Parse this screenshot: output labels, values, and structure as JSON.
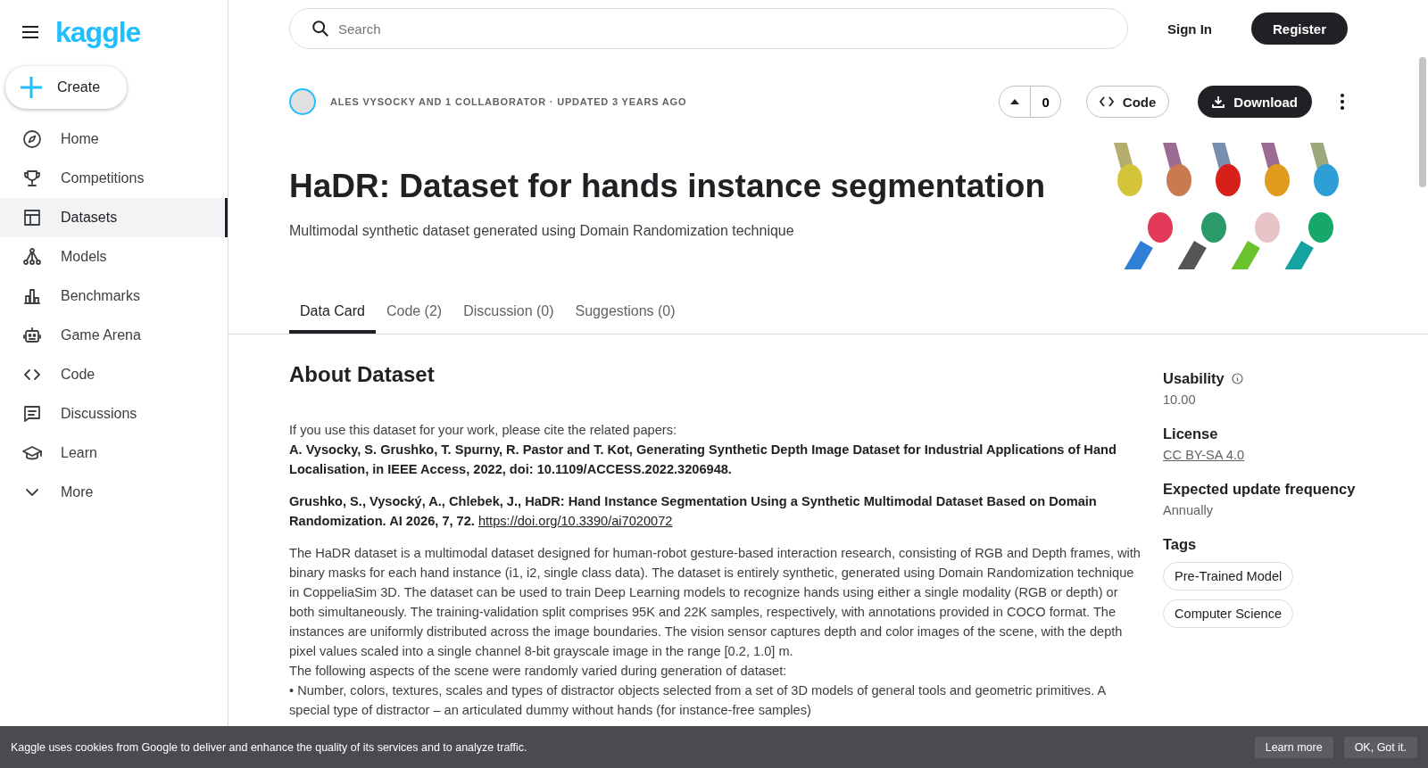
{
  "logo": "kaggle",
  "create_button": "Create",
  "nav": [
    {
      "label": "Home",
      "selected": false
    },
    {
      "label": "Competitions",
      "selected": false
    },
    {
      "label": "Datasets",
      "selected": true
    },
    {
      "label": "Models",
      "selected": false
    },
    {
      "label": "Benchmarks",
      "selected": false
    },
    {
      "label": "Game Arena",
      "selected": false
    },
    {
      "label": "Code",
      "selected": false
    },
    {
      "label": "Discussions",
      "selected": false
    },
    {
      "label": "Learn",
      "selected": false
    },
    {
      "label": "More",
      "selected": false
    }
  ],
  "search": {
    "placeholder": "Search"
  },
  "sign_in": "Sign In",
  "register": "Register",
  "byline": "ALES VYSOCKY AND 1 COLLABORATOR · UPDATED 3 YEARS AGO",
  "votes": "0",
  "code_button": "Code",
  "download_button": "Download",
  "title": "HaDR: Dataset for hands instance segmentation",
  "subtitle": "Multimodal synthetic dataset generated using Domain Randomization technique",
  "tabs": [
    {
      "label": "Data Card",
      "selected": true
    },
    {
      "label": "Code (2)",
      "selected": false
    },
    {
      "label": "Discussion (0)",
      "selected": false
    },
    {
      "label": "Suggestions (0)",
      "selected": false
    }
  ],
  "about": {
    "heading": "About Dataset",
    "intro": "If you use this dataset for your work, please cite the related papers:",
    "citation_1": "A. Vysocky, S. Grushko, T. Spurny, R. Pastor and T. Kot, Generating Synthetic Depth Image Dataset for Industrial Applications of Hand Localisation, in IEEE Access, 2022, doi: 10.1109/ACCESS.2022.3206948.",
    "citation_2": "Grushko, S., Vysocký, A., Chlebek, J., HaDR: Hand Instance Segmentation Using a Synthetic Multimodal Dataset Based on Domain Randomization. AI 2026, 7, 72.",
    "citation_2_link": "https://doi.org/10.3390/ai7020072",
    "description": "The HaDR dataset is a multimodal dataset designed for human-robot gesture-based interaction research, consisting of RGB and Depth frames, with binary masks for each hand instance (i1, i2, single class data). The dataset is entirely synthetic, generated using Domain Randomization technique in CoppeliaSim 3D. The dataset can be used to train Deep Learning models to recognize hands using either a single modality (RGB or depth) or both simultaneously. The training-validation split comprises 95K and 22K samples, respectively, with annotations provided in COCO format. The instances are uniformly distributed across the image boundaries. The vision sensor captures depth and color images of the scene, with the depth pixel values scaled into a single channel 8-bit grayscale image in the range [0.2, 1.0] m.",
    "aspects_intro": "The following aspects of the scene were randomly varied during generation of dataset:",
    "bullets": [
      "• Number, colors, textures, scales and types of distractor objects selected from a set of 3D models of general tools and geometric primitives. A special type of distractor – an articulated dummy without hands (for instance-free samples)"
    ]
  },
  "meta": [
    {
      "kind": "text",
      "label": "Usability",
      "info": true,
      "value": "10.00"
    },
    {
      "kind": "link",
      "label": "License",
      "info": false,
      "value": "CC BY-SA 4.0"
    },
    {
      "kind": "text",
      "label": "Expected update frequency",
      "info": false,
      "value": "Annually"
    }
  ],
  "tags": {
    "heading": "Tags",
    "items": [
      "Pre-Trained Model",
      "Computer Science"
    ]
  },
  "cookie": {
    "text": "Kaggle uses cookies from Google to deliver and enhance the quality of its services and to analyze traffic.",
    "buttons": [
      "Learn more",
      "OK, Got it."
    ]
  }
}
